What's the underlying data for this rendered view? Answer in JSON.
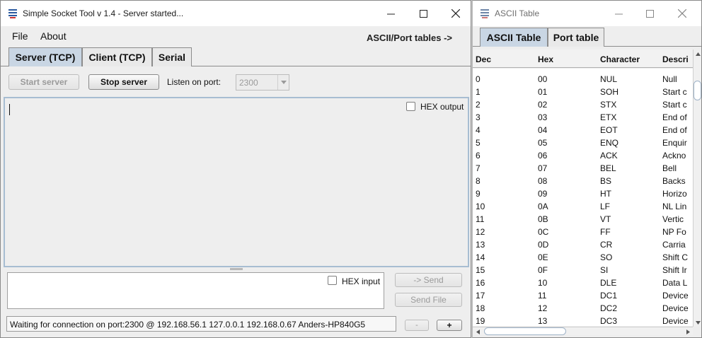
{
  "main_window": {
    "title": "Simple Socket Tool v 1.4 - Server started...",
    "menu": {
      "file": "File",
      "about": "About",
      "ascii_port_link": "ASCII/Port tables ->"
    },
    "tabs": [
      {
        "label": "Server (TCP)",
        "active": true
      },
      {
        "label": "Client (TCP)",
        "active": false
      },
      {
        "label": "Serial",
        "active": false
      }
    ],
    "toolbar": {
      "start_server": "Start server",
      "stop_server": "Stop server",
      "listen_on_port_label": "Listen on port:",
      "port_value": "2300"
    },
    "output": {
      "hex_output_label": "HEX output",
      "hex_output_checked": false,
      "text": ""
    },
    "input": {
      "hex_input_label": "HEX input",
      "hex_input_checked": false,
      "text": ""
    },
    "buttons": {
      "send": "-> Send",
      "send_file": "Send File",
      "minus": "-",
      "plus": "+"
    },
    "status": "Waiting for connection on port:2300 @ 192.168.56.1 127.0.0.1 192.168.0.67  Anders-HP840G5"
  },
  "ascii_window": {
    "title": "ASCII Table",
    "tabs": [
      {
        "label": "ASCII Table",
        "active": true
      },
      {
        "label": "Port table",
        "active": false
      }
    ],
    "columns": [
      "Dec",
      "Hex",
      "Character",
      "Descri"
    ],
    "rows": [
      [
        "0",
        "00",
        "NUL",
        "Null"
      ],
      [
        "1",
        "01",
        "SOH",
        "Start c"
      ],
      [
        "2",
        "02",
        "STX",
        "Start c"
      ],
      [
        "3",
        "03",
        "ETX",
        "End of"
      ],
      [
        "4",
        "04",
        "EOT",
        "End of"
      ],
      [
        "5",
        "05",
        "ENQ",
        "Enquir"
      ],
      [
        "6",
        "06",
        "ACK",
        "Ackno"
      ],
      [
        "7",
        "07",
        "BEL",
        "Bell"
      ],
      [
        "8",
        "08",
        "BS",
        "Backs"
      ],
      [
        "9",
        "09",
        "HT",
        "Horizo"
      ],
      [
        "10",
        "0A",
        "LF",
        "NL Lin"
      ],
      [
        "11",
        "0B",
        "VT",
        "Vertic"
      ],
      [
        "12",
        "0C",
        "FF",
        "NP Fo"
      ],
      [
        "13",
        "0D",
        "CR",
        "Carria"
      ],
      [
        "14",
        "0E",
        "SO",
        "Shift C"
      ],
      [
        "15",
        "0F",
        "SI",
        "Shift Ir"
      ],
      [
        "16",
        "10",
        "DLE",
        "Data L"
      ],
      [
        "17",
        "11",
        "DC1",
        "Device"
      ],
      [
        "18",
        "12",
        "DC2",
        "Device"
      ],
      [
        "19",
        "13",
        "DC3",
        "Device"
      ]
    ]
  },
  "icons": {
    "app": "java-cup-icon",
    "minimize": "minimize-icon",
    "maximize": "maximize-icon",
    "close": "close-icon",
    "dropdown": "chevron-down-icon"
  },
  "colors": {
    "active_tab": "#c9d6e4",
    "text_area_border": "#a7bdd2",
    "window_bg": "#eeeeee"
  }
}
